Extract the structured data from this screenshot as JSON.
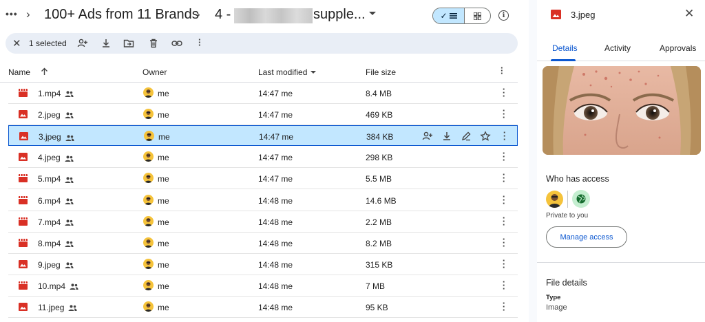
{
  "breadcrumb": {
    "more": "•••",
    "folder1": "100+ Ads from 11 Brands",
    "folder2_prefix": "4 - ",
    "folder2_suffix": "supple..."
  },
  "toolbar": {
    "selected_count": "1 selected"
  },
  "table": {
    "headers": {
      "name": "Name",
      "owner": "Owner",
      "modified": "Last modified",
      "size": "File size"
    },
    "rows": [
      {
        "name": "1.mp4",
        "type": "video",
        "owner": "me",
        "modified": "14:47 me",
        "size": "8.4 MB"
      },
      {
        "name": "2.jpeg",
        "type": "image",
        "owner": "me",
        "modified": "14:47 me",
        "size": "469 KB"
      },
      {
        "name": "3.jpeg",
        "type": "image",
        "owner": "me",
        "modified": "14:47 me",
        "size": "384 KB",
        "selected": true
      },
      {
        "name": "4.jpeg",
        "type": "image",
        "owner": "me",
        "modified": "14:47 me",
        "size": "298 KB"
      },
      {
        "name": "5.mp4",
        "type": "video",
        "owner": "me",
        "modified": "14:47 me",
        "size": "5.5 MB"
      },
      {
        "name": "6.mp4",
        "type": "video",
        "owner": "me",
        "modified": "14:48 me",
        "size": "14.6 MB"
      },
      {
        "name": "7.mp4",
        "type": "video",
        "owner": "me",
        "modified": "14:48 me",
        "size": "2.2 MB"
      },
      {
        "name": "8.mp4",
        "type": "video",
        "owner": "me",
        "modified": "14:48 me",
        "size": "8.2 MB"
      },
      {
        "name": "9.jpeg",
        "type": "image",
        "owner": "me",
        "modified": "14:48 me",
        "size": "315 KB"
      },
      {
        "name": "10.mp4",
        "type": "video",
        "owner": "me",
        "modified": "14:48 me",
        "size": "7 MB"
      },
      {
        "name": "11.jpeg",
        "type": "image",
        "owner": "me",
        "modified": "14:48 me",
        "size": "95 KB"
      }
    ]
  },
  "details": {
    "file_name": "3.jpeg",
    "tabs": [
      "Details",
      "Activity",
      "Approvals"
    ],
    "access_title": "Who has access",
    "private_text": "Private to you",
    "manage_label": "Manage access",
    "file_details_title": "File details",
    "type_label": "Type",
    "type_value": "Image"
  },
  "colors": {
    "accent": "#0b57d0",
    "selected_bg": "#c2e7ff",
    "file_red": "#d93025",
    "toolbar_bg": "#e9eef6"
  }
}
